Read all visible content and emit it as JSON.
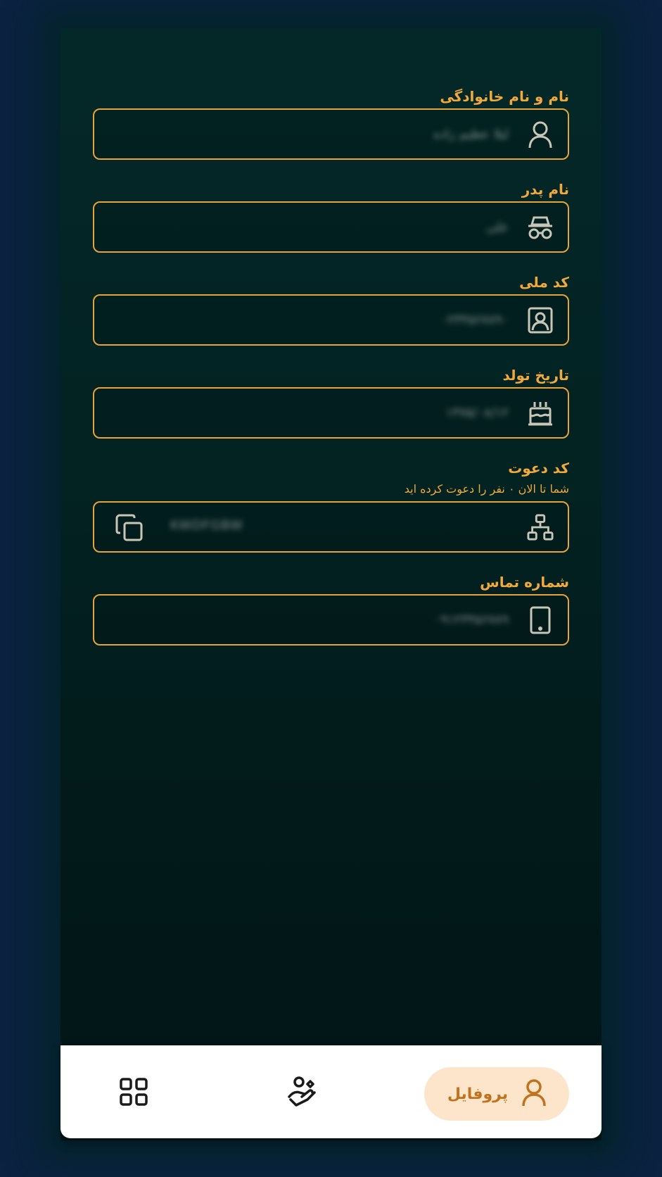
{
  "form": {
    "full_name": {
      "label": "نام و نام خانوادگی",
      "value": "لیلا عظیم زاده",
      "icon": "user-icon"
    },
    "father_name": {
      "label": "نام پدر",
      "value": "علی",
      "icon": "incognito-icon"
    },
    "national_code": {
      "label": "کد ملی",
      "value": "۰۲۳۴۵۶۷۸۹۰",
      "icon": "id-card-icon"
    },
    "birth_date": {
      "label": "تاریخ تولد",
      "value": "۱۳۷۵/۰۸/۱۲",
      "icon": "cake-icon"
    },
    "invite_code": {
      "label": "کد دعوت",
      "sublabel": "شما تا الان ۰ نفر را دعوت کرده اید",
      "value": "KWDFGBW",
      "icon": "network-icon",
      "action_icon": "copy-icon"
    },
    "phone": {
      "label": "شماره تماس",
      "value": "۰۹۱۲۳۴۵۶۷۸۹",
      "icon": "mobile-icon"
    }
  },
  "bottom_nav": {
    "items": [
      {
        "name": "dashboard",
        "icon": "grid-icon"
      },
      {
        "name": "care",
        "icon": "hand-heart-icon"
      },
      {
        "name": "profile",
        "label": "پروفایل",
        "icon": "user-icon",
        "active": true
      }
    ]
  },
  "colors": {
    "accent": "#e6a43a",
    "label": "#f0a93a",
    "background": "#0b2240",
    "panel": "#032222",
    "active_pill": "#fde5cc",
    "active_text": "#c0721d"
  }
}
